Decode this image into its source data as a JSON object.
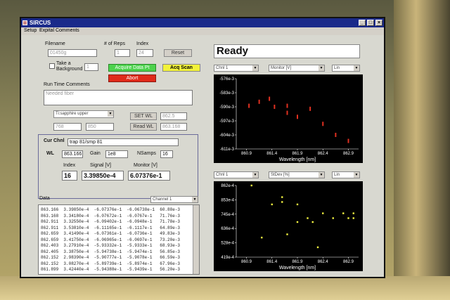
{
  "app": {
    "title": "SIRCUS"
  },
  "window_buttons": {
    "minimize": "_",
    "maximize": "□",
    "close": "×"
  },
  "menu": [
    "Setup",
    "Expital Comments"
  ],
  "filename": {
    "label": "Filename",
    "value": "01450g"
  },
  "reps": {
    "label": "# of Reps",
    "value": "1"
  },
  "index_top": {
    "label": "Index",
    "value": "24"
  },
  "reset_label": "Reset",
  "background": {
    "label": "Take a Background",
    "value": "1"
  },
  "acquire_label": "Acquire Data Pt",
  "acq_scan_label": "Acq Scan",
  "abort_label": "Abort",
  "runtime": {
    "label": "Run Time Comments",
    "value": "Needed fiber"
  },
  "source_select": "Ti:sapphire upper",
  "wl_fields": {
    "a": "768",
    "b": "850",
    "set_wl": "SET WL",
    "set_wl_val": "862.5",
    "read_wl": "Read WL",
    "read_wl_val": "863.168"
  },
  "chan": {
    "title": "Cur Chnl",
    "chan_val": "trap 81/smp 81",
    "wl_label": "WL",
    "wl_val": "863.166",
    "gain_label": "Gain",
    "gain_val": "1e8",
    "nsamps_label": "NSamps",
    "nsamps_val": "16",
    "index_label": "Index",
    "index_val": "16",
    "signal_label": "Signal [V]",
    "signal_val": "3.39850e-4",
    "monitor_label": "Monitor [V]",
    "monitor_val": "6.07376e-1"
  },
  "data": {
    "label": "Data",
    "channel_select": "Channel 1",
    "rows": [
      "863.166  3.39850e-4  -6.07376e-1  -6.06738e-1  60.88e-3",
      "863.168  3.34180e-4  -6.07672e-1  -6.0767e-1   71.76e-3",
      "862.911  3.32550e-4  -6.09402e-1  -6.0948e-1   71.78e-3",
      "862.911  3.53810e-4  -6.11165e-1  -6.1117e-1   64.89e-3",
      "862.659  3.41490e-4  -6.07361e-1  -6.0736e-1   49.83e-3",
      "862.659  3.41750e-4  -6.06965e-1  -6.0697e-1   73.20e-3",
      "862.403  3.27910e-4  -5.93332e-1  -5.9333e-1   68.93e-3",
      "862.405  3.38750e-4  -5.94738e-1  -5.9474e-1   56.85e-3",
      "862.152  2.98390e-4  -5.90777e-1  -5.9078e-1   66.59e-3",
      "862.152  3.08270e-4  -5.89739e-1  -5.8974e-1   67.96e-3",
      "861.899  3.42440e-4  -5.94388e-1  -5.9439e-1   56.20e-3"
    ]
  },
  "status": "Ready",
  "plot1": {
    "sel1": "Chnl 1",
    "sel2": "Monitor [V]",
    "sel3": "Lin",
    "yticks": [
      "-576e-3",
      "-583e-3",
      "-590e-3",
      "-597e-3",
      "-604e-3",
      "-611e-3"
    ],
    "xticks": [
      "860.9",
      "861.4",
      "861.9",
      "862.4",
      "862.9"
    ],
    "xlabel": "Wavelength [nm]",
    "points": [
      [
        860.95,
        -0.5895
      ],
      [
        861.15,
        -0.5875
      ],
      [
        861.35,
        -0.586
      ],
      [
        861.45,
        -0.59
      ],
      [
        861.7,
        -0.5895
      ],
      [
        861.7,
        -0.593
      ],
      [
        861.9,
        -0.595
      ],
      [
        862.15,
        -0.591
      ],
      [
        862.4,
        -0.5985
      ],
      [
        862.65,
        -0.604
      ],
      [
        862.9,
        -0.607
      ]
    ]
  },
  "plot2": {
    "sel1": "Chnl 1",
    "sel2": "StDev [%]",
    "sel3": "Lin",
    "yticks": [
      "862e-4",
      "853e-4",
      "745e-4",
      "636e-4",
      "528e-4",
      "419e-4"
    ],
    "xticks": [
      "860.9",
      "861.4",
      "861.9",
      "862.4",
      "862.9"
    ],
    "xlabel": "Wavelength [nm]",
    "points": [
      [
        861.0,
        862
      ],
      [
        861.4,
        745
      ],
      [
        861.6,
        790
      ],
      [
        861.6,
        760
      ],
      [
        861.9,
        745
      ],
      [
        861.9,
        636
      ],
      [
        862.1,
        660
      ],
      [
        862.2,
        636
      ],
      [
        862.4,
        690
      ],
      [
        862.6,
        660
      ],
      [
        862.8,
        690
      ],
      [
        862.9,
        660
      ],
      [
        863.0,
        690
      ],
      [
        863.0,
        660
      ],
      [
        861.2,
        540
      ],
      [
        862.3,
        480
      ],
      [
        861.7,
        560
      ]
    ]
  }
}
